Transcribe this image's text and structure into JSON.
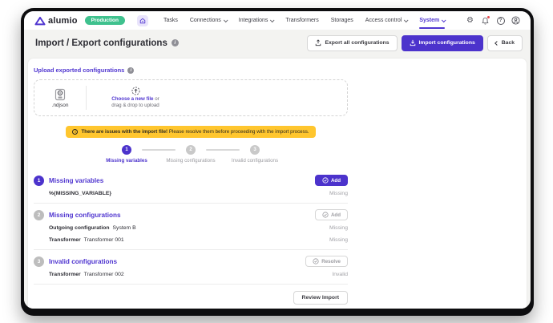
{
  "header": {
    "logo_text": "alumio",
    "env_badge": "Production",
    "nav": [
      {
        "label": "Tasks"
      },
      {
        "label": "Connections"
      },
      {
        "label": "Integrations"
      },
      {
        "label": "Transformers"
      },
      {
        "label": "Storages"
      },
      {
        "label": "Access control"
      },
      {
        "label": "System"
      }
    ]
  },
  "icons": {
    "settings_glyph": "⚙",
    "help_glyph": "?",
    "info_glyph": "i"
  },
  "title_bar": {
    "title": "Import / Export configurations",
    "export_button": "Export all configurations",
    "import_button": "Import configurations",
    "back_button": "Back"
  },
  "upload": {
    "section_label": "Upload exported configurations",
    "file_type": ".ndjson",
    "choose_link": "Choose a new file",
    "choose_suffix": "or",
    "drop_text": "drag & drop to upload"
  },
  "warning": {
    "bold": "There are issues with the import file!",
    "text": "Please resolve them before proceeding with the import process."
  },
  "stepper": {
    "steps": [
      {
        "num": "1",
        "label": "Missing variables"
      },
      {
        "num": "2",
        "label": "Missing configurations"
      },
      {
        "num": "3",
        "label": "Invalid configurations"
      }
    ]
  },
  "sections": [
    {
      "num": "1",
      "title": "Missing variables",
      "action": "Add",
      "rows": [
        {
          "label": "%{MISSING_VARIABLE}",
          "value": "",
          "status": "Missing"
        }
      ]
    },
    {
      "num": "2",
      "title": "Missing configurations",
      "action": "Add",
      "rows": [
        {
          "label": "Outgoing configuration",
          "value": "System B",
          "status": "Missing"
        },
        {
          "label": "Transformer",
          "value": "Transformer 001",
          "status": "Missing"
        }
      ]
    },
    {
      "num": "3",
      "title": "Invalid configurations",
      "action": "Resolve",
      "rows": [
        {
          "label": "Transformer",
          "value": "Transformer 002",
          "status": "Invalid"
        }
      ]
    }
  ],
  "footer": {
    "review_button": "Review Import"
  },
  "colors": {
    "primary_purple": "#4c33cc",
    "link_purple": "#5036d0",
    "badge_green": "#3fc18e",
    "warning_yellow": "#ffc62e",
    "status_gray": "#a2a2a7",
    "page_bg": "#f3f3f1"
  }
}
